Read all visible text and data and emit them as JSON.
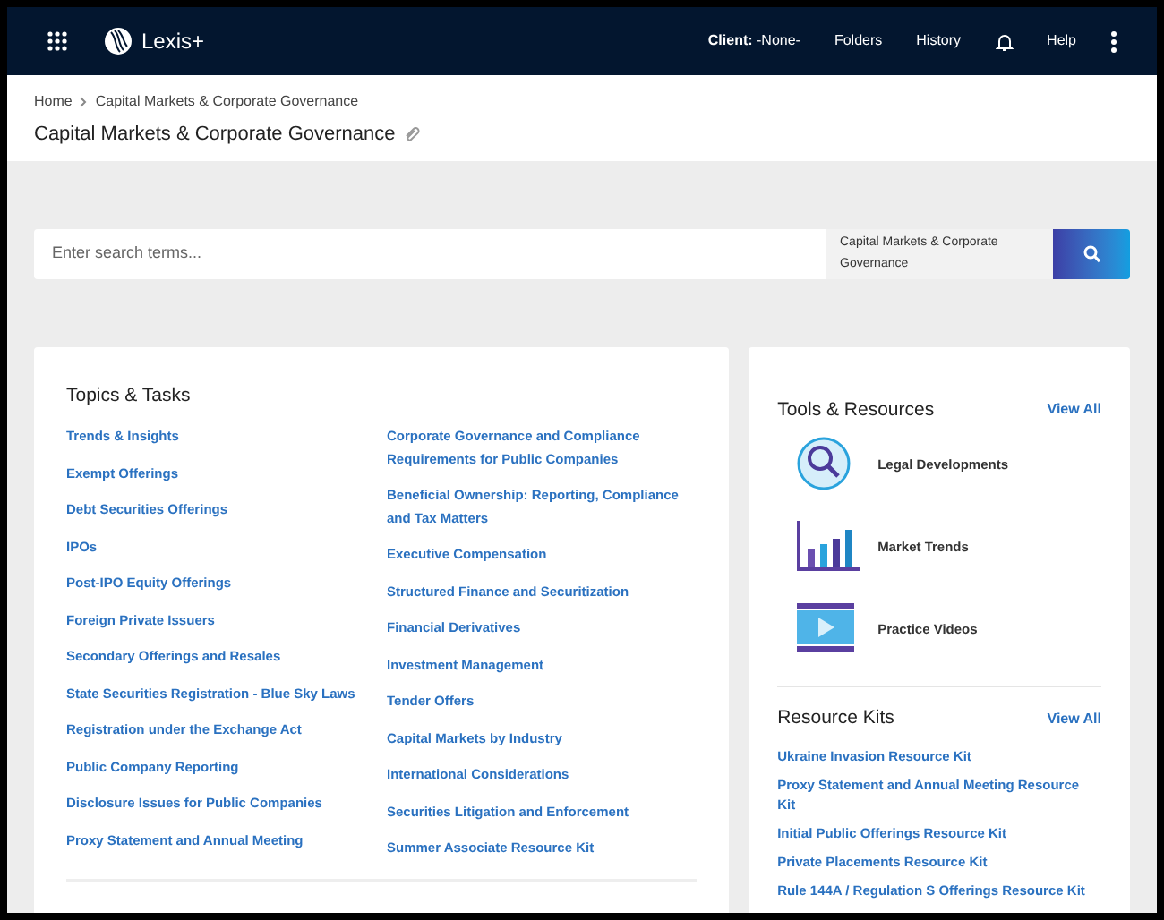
{
  "header": {
    "brand": "Lexis+",
    "nav": [
      {
        "kind": "text",
        "label": "**Client:** -None-"
      },
      {
        "kind": "text",
        "label": "Folders"
      },
      {
        "kind": "text",
        "label": "History"
      },
      {
        "kind": "bell"
      },
      {
        "kind": "text",
        "label": "Help"
      },
      {
        "kind": "more"
      }
    ]
  },
  "breadcrumb": [
    "Home",
    "Capital Markets & Corporate Governance"
  ],
  "page_title": "Capital Markets & Corporate Governance",
  "search": {
    "placeholder": "Enter search terms...",
    "scope": "Capital Markets & Corporate Governance"
  },
  "topics": {
    "title": "Topics & Tasks",
    "columns": [
      [
        "Trends & Insights",
        "Exempt Offerings",
        "Debt Securities Offerings",
        "IPOs",
        "Post-IPO Equity Offerings",
        "Foreign Private Issuers",
        "Secondary Offerings and Resales",
        "State Securities Registration - Blue Sky Laws",
        "Registration under the Exchange Act",
        "Public Company Reporting",
        "Disclosure Issues for Public Companies",
        "Proxy Statement and Annual Meeting"
      ],
      [
        "Corporate Governance and Compliance Requirements for Public Companies",
        "Beneficial Ownership: Reporting, Compliance and Tax Matters",
        "Executive Compensation",
        "Structured Finance and Securitization",
        "Financial Derivatives",
        "Investment Management",
        "Tender Offers",
        "Capital Markets by Industry",
        "International Considerations",
        "Securities Litigation and Enforcement",
        "Summer Associate Resource Kit"
      ]
    ]
  },
  "tools": {
    "title": "Tools & Resources",
    "view_all": "View All",
    "items": [
      {
        "kind": "search",
        "label": "Legal Developments"
      },
      {
        "kind": "chart",
        "label": "Market Trends"
      },
      {
        "kind": "video",
        "label": "Practice Videos"
      }
    ]
  },
  "resource_kits": {
    "title": "Resource Kits",
    "view_all": "View All",
    "items": [
      "Ukraine Invasion Resource Kit",
      "Proxy Statement and Annual Meeting Resource Kit",
      "Initial Public Offerings Resource Kit",
      "Private Placements Resource Kit",
      "Rule 144A / Regulation S Offerings Resource Kit"
    ]
  }
}
